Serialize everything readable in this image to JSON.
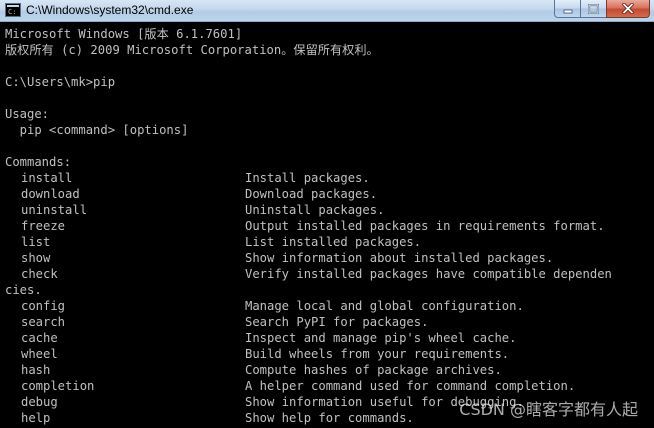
{
  "window": {
    "title": "C:\\Windows\\system32\\cmd.exe",
    "icon": "cmd-console-icon"
  },
  "console": {
    "header_line_1": "Microsoft Windows [版本 6.1.7601]",
    "header_line_2": "版权所有 (c) 2009 Microsoft Corporation。保留所有权利。",
    "prompt": "C:\\Users\\mk>pip",
    "usage_label": "Usage:",
    "usage_text": "  pip <command> [options]",
    "commands_label": "Commands:",
    "commands": [
      {
        "name": "install",
        "desc": "Install packages."
      },
      {
        "name": "download",
        "desc": "Download packages."
      },
      {
        "name": "uninstall",
        "desc": "Uninstall packages."
      },
      {
        "name": "freeze",
        "desc": "Output installed packages in requirements format."
      },
      {
        "name": "list",
        "desc": "List installed packages."
      },
      {
        "name": "show",
        "desc": "Show information about installed packages."
      },
      {
        "name": "check",
        "desc": "Verify installed packages have compatible dependen"
      },
      {
        "name": "config",
        "desc": "Manage local and global configuration."
      },
      {
        "name": "search",
        "desc": "Search PyPI for packages."
      },
      {
        "name": "cache",
        "desc": "Inspect and manage pip's wheel cache."
      },
      {
        "name": "wheel",
        "desc": "Build wheels from your requirements."
      },
      {
        "name": "hash",
        "desc": "Compute hashes of package archives."
      },
      {
        "name": "completion",
        "desc": "A helper command used for command completion."
      },
      {
        "name": "debug",
        "desc": "Show information useful for debugging."
      },
      {
        "name": "help",
        "desc": "Show help for commands."
      }
    ],
    "wrap_continuation": "cies."
  },
  "watermark": "CSDN @瞎客字都有人起",
  "colors": {
    "console_bg": "#000000",
    "console_text": "#c0c0c0",
    "close_button": "#c44a32"
  }
}
